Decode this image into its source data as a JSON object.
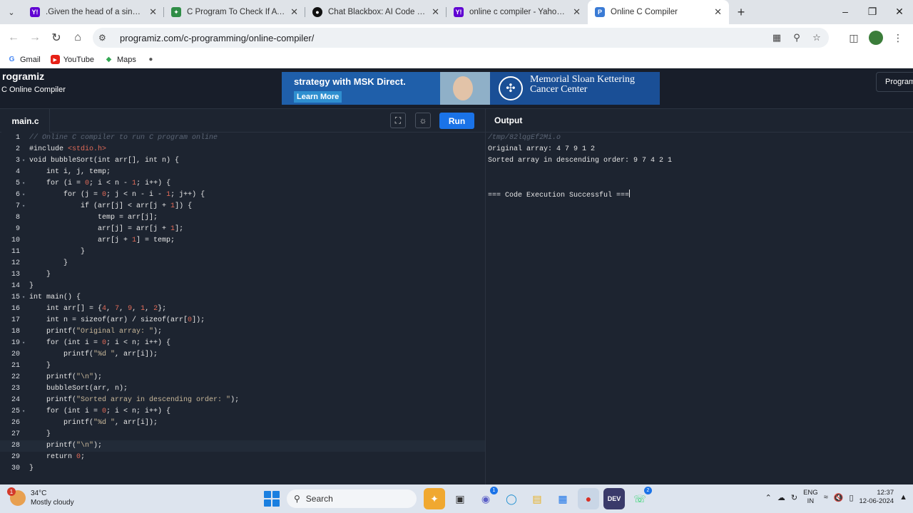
{
  "browser": {
    "tabs": [
      {
        "title": ".Given the head of a singly linke",
        "favicon": "Y!",
        "favicon_color": "#6001d2"
      },
      {
        "title": "C Program To Check If A Singly",
        "favicon": "✦",
        "favicon_color": "#2f8d46"
      },
      {
        "title": "Chat Blackbox: AI Code Generat",
        "favicon": "●",
        "favicon_color": "#111111"
      },
      {
        "title": "online c compiler - Yahoo India",
        "favicon": "Y!",
        "favicon_color": "#6001d2"
      },
      {
        "title": "Online C Compiler",
        "favicon": "P",
        "favicon_color": "#3a7bd5"
      }
    ],
    "url": "programiz.com/c-programming/online-compiler/",
    "bookmarks": [
      {
        "label": "Gmail",
        "icon": "G"
      },
      {
        "label": "YouTube",
        "icon": "▶"
      },
      {
        "label": "Maps",
        "icon": "◆"
      }
    ]
  },
  "site": {
    "logo": "rogramiz",
    "subtitle": "C Online Compiler",
    "ad_headline": "strategy with MSK Direct.",
    "ad_button": "Learn More",
    "ad_brand_line1": "Memorial Sloan Kettering",
    "ad_brand_line2": "Cancer Center",
    "header_button": "Programiz"
  },
  "editor": {
    "file_tab": "main.c",
    "run_label": "Run",
    "output_title": "Output"
  },
  "code_lines": [
    "// Online C compiler to run C program online",
    "#include <stdio.h>",
    "void bubbleSort(int arr[], int n) {",
    "    int i, j, temp;",
    "    for (i = 0; i < n - 1; i++) {",
    "        for (j = 0; j < n - i - 1; j++) {",
    "            if (arr[j] < arr[j + 1]) {",
    "                temp = arr[j];",
    "                arr[j] = arr[j + 1];",
    "                arr[j + 1] = temp;",
    "            }",
    "        }",
    "    }",
    "}",
    "int main() {",
    "    int arr[] = {4, 7, 9, 1, 2};",
    "    int n = sizeof(arr) / sizeof(arr[0]);",
    "    printf(\"Original array: \");",
    "    for (int i = 0; i < n; i++) {",
    "        printf(\"%d \", arr[i]);",
    "    }",
    "    printf(\"\\n\");",
    "    bubbleSort(arr, n);",
    "    printf(\"Sorted array in descending order: \");",
    "    for (int i = 0; i < n; i++) {",
    "        printf(\"%d \", arr[i]);",
    "    }",
    "    printf(\"\\n\");",
    "    return 0;",
    "}"
  ],
  "fold_lines": [
    3,
    5,
    6,
    7,
    15,
    19,
    25
  ],
  "active_line": 28,
  "output": {
    "path": "/tmp/82lqgEf2Mi.o",
    "lines": [
      "Original array: 4 7 9 1 2",
      "Sorted array in descending order: 9 7 4 2 1",
      "",
      "",
      "=== Code Execution Successful ==="
    ]
  },
  "taskbar": {
    "temperature": "34°C",
    "weather": "Mostly cloudy",
    "weather_badge": "1",
    "search_label": "Search",
    "lang_line1": "ENG",
    "lang_line2": "IN",
    "time": "12:37",
    "date": "12-06-2024",
    "teams_badge": "1",
    "whatsapp_badge": "2"
  }
}
